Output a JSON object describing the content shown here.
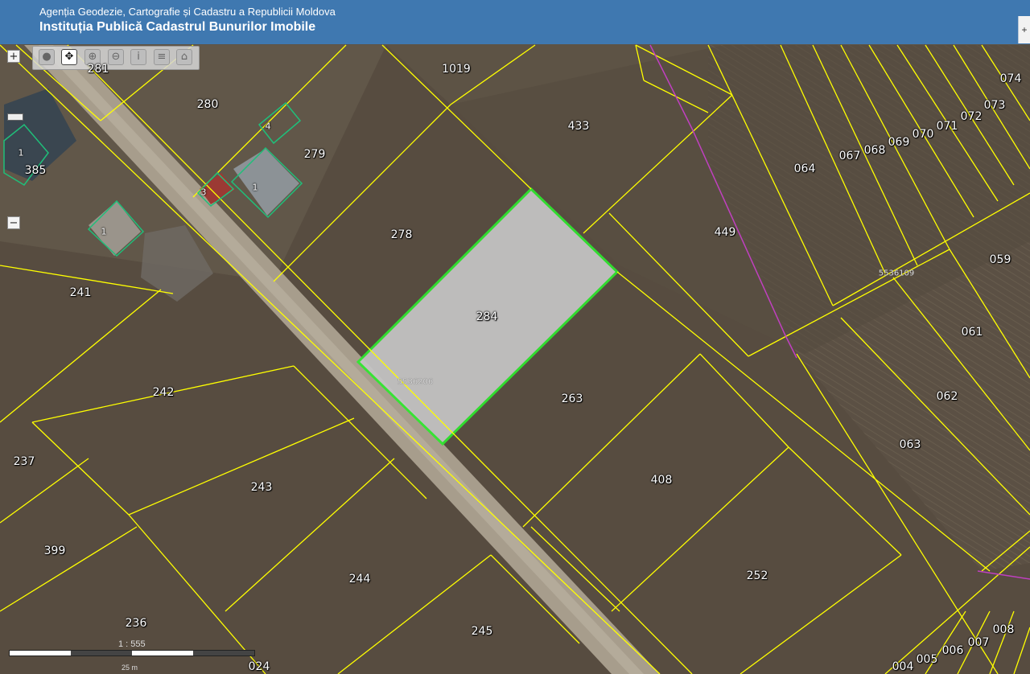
{
  "header": {
    "agency": "Agenția Geodezie, Cartografie și Cadastru a Republicii Moldova",
    "institution": "Instituția Publică Cadastrul Bunurilor Imobile",
    "corner_button": "+"
  },
  "map_controls": {
    "zoom_in": "+",
    "zoom_out": "−",
    "tools": [
      {
        "name": "globe-icon",
        "glyph": "●"
      },
      {
        "name": "pan-icon",
        "glyph": "✥"
      },
      {
        "name": "zoom-in-icon",
        "glyph": "⊕"
      },
      {
        "name": "zoom-out-icon",
        "glyph": "⊖"
      },
      {
        "name": "info-icon",
        "glyph": "i"
      },
      {
        "name": "layers-icon",
        "glyph": "≡"
      },
      {
        "name": "building-icon",
        "glyph": "⌂"
      }
    ]
  },
  "scale": {
    "ratio": "1 : 555",
    "distance": "25 m"
  },
  "parcels": [
    {
      "id": "281"
    },
    {
      "id": "280"
    },
    {
      "id": "1019"
    },
    {
      "id": "433"
    },
    {
      "id": "279"
    },
    {
      "id": "278"
    },
    {
      "id": "284",
      "selected": true
    },
    {
      "id": "263"
    },
    {
      "id": "449"
    },
    {
      "id": "064"
    },
    {
      "id": "067"
    },
    {
      "id": "068"
    },
    {
      "id": "069"
    },
    {
      "id": "070"
    },
    {
      "id": "071"
    },
    {
      "id": "072"
    },
    {
      "id": "073"
    },
    {
      "id": "074"
    },
    {
      "id": "059"
    },
    {
      "id": "061"
    },
    {
      "id": "062"
    },
    {
      "id": "063"
    },
    {
      "id": "385"
    },
    {
      "id": "241"
    },
    {
      "id": "242"
    },
    {
      "id": "237"
    },
    {
      "id": "243"
    },
    {
      "id": "244"
    },
    {
      "id": "408"
    },
    {
      "id": "252"
    },
    {
      "id": "399"
    },
    {
      "id": "236"
    },
    {
      "id": "245"
    },
    {
      "id": "008"
    },
    {
      "id": "007"
    },
    {
      "id": "006"
    },
    {
      "id": "005"
    },
    {
      "id": "004"
    },
    {
      "id": "024"
    }
  ],
  "building_numbers": [
    "4",
    "1",
    "3",
    "1",
    "1"
  ],
  "sectors": [
    "5536206",
    "5536109"
  ],
  "colors": {
    "header": "#3f78b0",
    "parcel_border": "#ffff00",
    "selected_border": "#2ee82e",
    "selected_fill": "#c6c6c6",
    "building_border": "#1fbf7a",
    "sector_border": "#c040c0"
  }
}
